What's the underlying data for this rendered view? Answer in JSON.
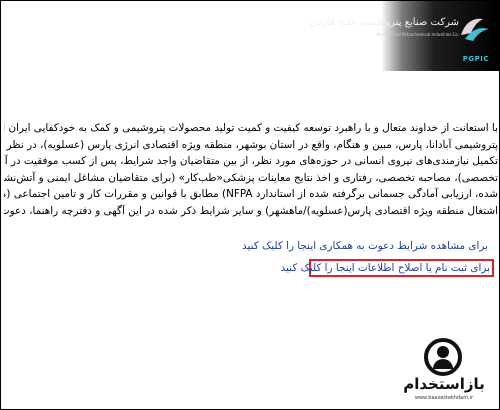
{
  "header": {
    "logo_title": "شرکت صنایع پتروشیمی خلیج فارس",
    "logo_subtitle_line1": "Persian Gulf Petrochemical Industries Co.",
    "logo_subtitle_line2": "",
    "logo_abbr": "PGPIC",
    "logo_icon": "pgpic-logo-icon"
  },
  "body": {
    "lines": [
      "با استعانت از خداوند متعال و با راهبرد توسعه کیفیت و کمیت تولید محصولات پتروشیمی و کمک به خودکفایی ایران اسلامی، شرکت‌های",
      "پتروشیمی آبادانا، پارس، مبین و هنگام، واقع در استان بوشهر، منطقه ویژه اقتصادی انرژی پارس (عسلویه)، در نظر دارد، به منظور تامین و",
      "تکمیل نیازمندی‌های نیروی انسانی در حوزه‌های مورد نظر، از بین متقاضیان واجد شرایط، پس از کسب موفقیت در آزمون‌های کتبی (عمومی و",
      "تخصصی)، مصاحبه تخصصی، رفتاری و اخذ نتایج معاینات پزشکی«طب‌کار» (برای متقاضیان مشاغل ایمنی و آتش‌نشانی علاوه بر موارد ذکر",
      "شده، ارزیابی آمادگی جسمانی برگرفته شده از استاندارد NFPA) مطابق با قوانین و مقررات کار و تامین اجتماعی (مقررات اداره کار و خدمات",
      "اشتغال منطقه ویژه اقتصادی پارس(عسلویه)/ماهشهر) و سایر شرایط ذکر شده در این آگهی و دفترچه راهنما، دعوت به همکاری نماید."
    ],
    "link_terms": "برای مشاهده شرایط دعوت به همکاری اینجا را کلیک کنید",
    "link_register": "برای ثبت نام یا اصلاح اطلاعات اینجا را کلیک کنید"
  },
  "watermark": {
    "text": "بازاستخدام",
    "url": "www.baazestekhdam.ir",
    "icon": "user-avatar-icon"
  }
}
